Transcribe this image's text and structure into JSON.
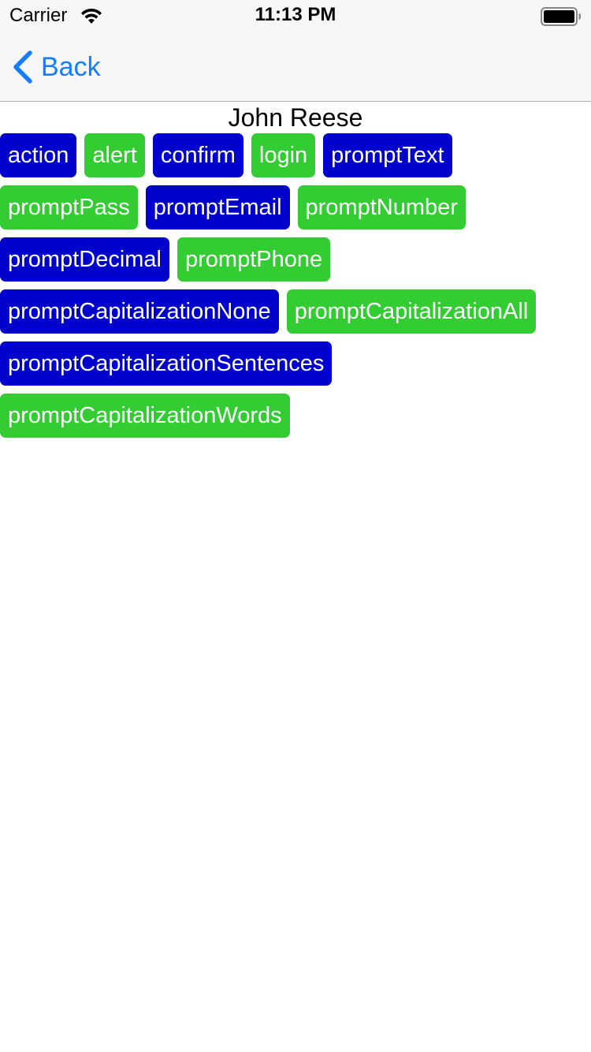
{
  "status_bar": {
    "carrier": "Carrier",
    "time": "11:13 PM"
  },
  "nav": {
    "back_label": "Back",
    "accent_color": "#147efb"
  },
  "title": "John Reese",
  "colors": {
    "blue": "#0000cc",
    "green": "#33cc33"
  },
  "buttons": [
    [
      {
        "label": "action",
        "color": "blue"
      },
      {
        "label": "alert",
        "color": "green"
      },
      {
        "label": "confirm",
        "color": "blue"
      },
      {
        "label": "login",
        "color": "green"
      },
      {
        "label": "promptText",
        "color": "blue"
      }
    ],
    [
      {
        "label": "promptPass",
        "color": "green"
      },
      {
        "label": "promptEmail",
        "color": "blue"
      },
      {
        "label": "promptNumber",
        "color": "green"
      }
    ],
    [
      {
        "label": "promptDecimal",
        "color": "blue"
      },
      {
        "label": "promptPhone",
        "color": "green"
      }
    ],
    [
      {
        "label": "promptCapitalizationNone",
        "color": "blue"
      },
      {
        "label": "promptCapitalizationAll",
        "color": "green"
      }
    ],
    [
      {
        "label": "promptCapitalizationSentences",
        "color": "blue"
      }
    ],
    [
      {
        "label": "promptCapitalizationWords",
        "color": "green"
      }
    ]
  ]
}
